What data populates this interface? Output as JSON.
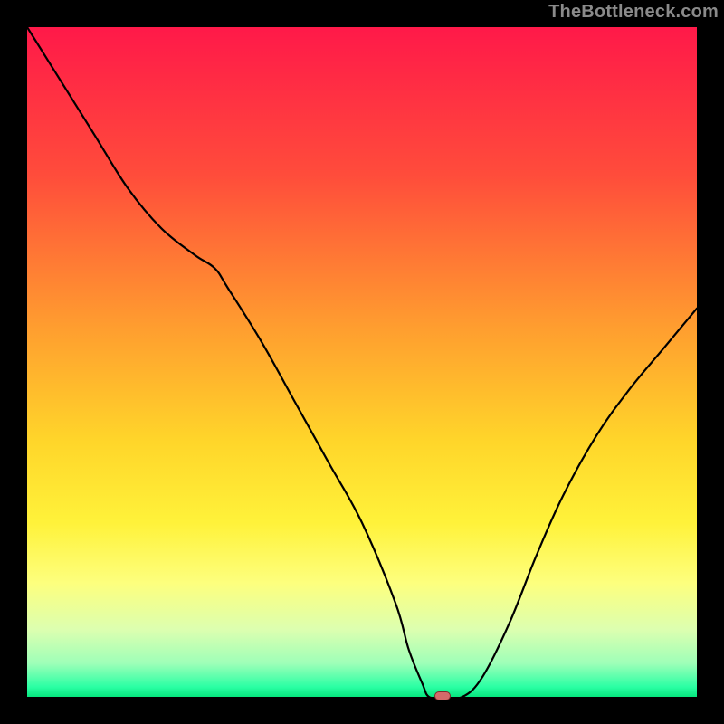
{
  "attribution": "TheBottleneck.com",
  "chart_data": {
    "type": "line",
    "title": "",
    "xlabel": "",
    "ylabel": "",
    "xlim": [
      0,
      100
    ],
    "ylim": [
      0,
      100
    ],
    "x": [
      0,
      5,
      10,
      15,
      20,
      25,
      28,
      30,
      35,
      40,
      45,
      50,
      55,
      57,
      59,
      60,
      62,
      65,
      68,
      72,
      76,
      80,
      85,
      90,
      95,
      100
    ],
    "values": [
      100,
      92,
      84,
      76,
      70,
      66,
      64,
      61,
      53,
      44,
      35,
      26,
      14,
      7,
      2,
      0,
      0,
      0,
      3,
      11,
      21,
      30,
      39,
      46,
      52,
      58
    ],
    "gradient_stops": [
      {
        "pos": 0.0,
        "color": "#ff1949"
      },
      {
        "pos": 0.22,
        "color": "#ff4c3b"
      },
      {
        "pos": 0.45,
        "color": "#ff9e2f"
      },
      {
        "pos": 0.62,
        "color": "#ffd62a"
      },
      {
        "pos": 0.74,
        "color": "#fff23a"
      },
      {
        "pos": 0.83,
        "color": "#fdff7e"
      },
      {
        "pos": 0.9,
        "color": "#dcffb0"
      },
      {
        "pos": 0.95,
        "color": "#9effb8"
      },
      {
        "pos": 0.985,
        "color": "#2bffa4"
      },
      {
        "pos": 1.0,
        "color": "#06e67e"
      }
    ],
    "marker": {
      "x": 62,
      "y": 0.2,
      "fill": "#d46a6a",
      "stroke": "#7a2d2d"
    }
  }
}
